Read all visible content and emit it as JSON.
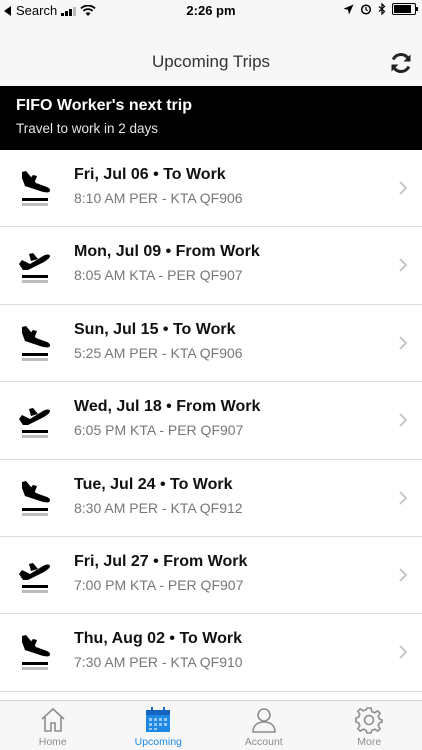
{
  "status_bar": {
    "carrier": "Search",
    "time": "2:26 pm"
  },
  "nav": {
    "title": "Upcoming Trips",
    "refresh_icon": "refresh-icon"
  },
  "banner": {
    "title": "FIFO Worker's next trip",
    "subtitle": "Travel to work in 2 days"
  },
  "trips": [
    {
      "title": "Fri, Jul 06 • To Work",
      "details": "8:10 AM PER - KTA  QF906",
      "direction": "landing"
    },
    {
      "title": "Mon, Jul 09 • From Work",
      "details": "8:05 AM KTA - PER  QF907",
      "direction": "takeoff"
    },
    {
      "title": "Sun, Jul 15 • To Work",
      "details": "5:25 AM PER - KTA  QF906",
      "direction": "landing"
    },
    {
      "title": "Wed, Jul 18 • From Work",
      "details": "6:05 PM KTA - PER  QF907",
      "direction": "takeoff"
    },
    {
      "title": "Tue, Jul 24 • To Work",
      "details": "8:30 AM PER - KTA  QF912",
      "direction": "landing"
    },
    {
      "title": "Fri, Jul 27 • From Work",
      "details": "7:00 PM KTA - PER  QF907",
      "direction": "takeoff"
    },
    {
      "title": "Thu, Aug 02 • To Work",
      "details": "7:30 AM PER - KTA  QF910",
      "direction": "landing"
    }
  ],
  "tabs": [
    {
      "label": "Home",
      "icon": "home-icon",
      "active": false
    },
    {
      "label": "Upcoming",
      "icon": "calendar-icon",
      "active": true
    },
    {
      "label": "Account",
      "icon": "person-icon",
      "active": false
    },
    {
      "label": "More",
      "icon": "gear-icon",
      "active": false
    }
  ],
  "colors": {
    "accent": "#1e88e5",
    "banner_bg": "#000000",
    "bar_bg": "#f7f7f7"
  }
}
